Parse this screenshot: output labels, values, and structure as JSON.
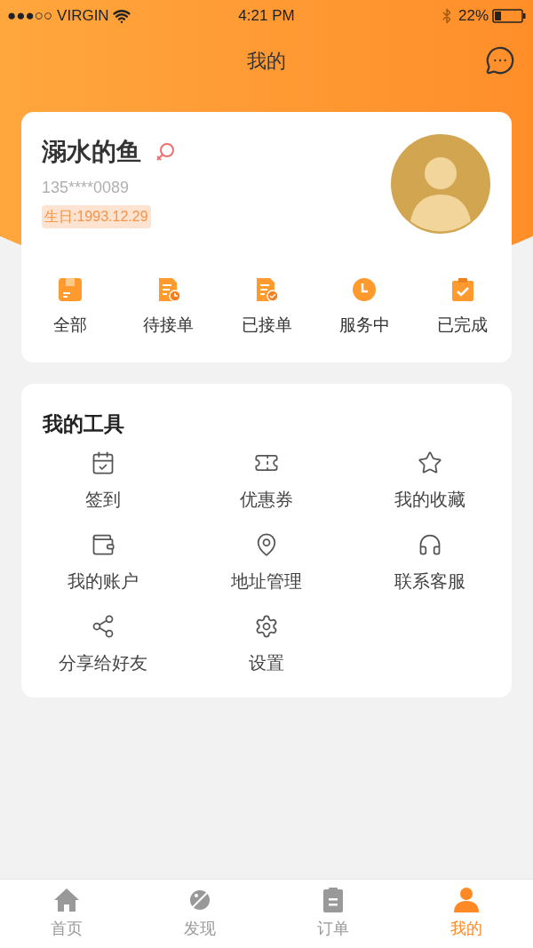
{
  "status_bar": {
    "carrier": "●●●○○ VIRGIN",
    "time": "4:21 PM",
    "battery": "22%"
  },
  "header": {
    "title": "我的"
  },
  "profile": {
    "name": "溺水的鱼",
    "phone": "135****0089",
    "birthday": "生日:1993.12.29"
  },
  "order_tabs": [
    {
      "label": "全部"
    },
    {
      "label": "待接单"
    },
    {
      "label": "已接单"
    },
    {
      "label": "服务中"
    },
    {
      "label": "已完成"
    }
  ],
  "tools": {
    "title": "我的工具",
    "items": [
      {
        "label": "签到"
      },
      {
        "label": "优惠券"
      },
      {
        "label": "我的收藏"
      },
      {
        "label": "我的账户"
      },
      {
        "label": "地址管理"
      },
      {
        "label": "联系客服"
      },
      {
        "label": "分享给好友"
      },
      {
        "label": "设置"
      }
    ]
  },
  "tab_bar": [
    {
      "label": "首页",
      "selected": false
    },
    {
      "label": "发现",
      "selected": false
    },
    {
      "label": "订单",
      "selected": false
    },
    {
      "label": "我的",
      "selected": true
    }
  ]
}
